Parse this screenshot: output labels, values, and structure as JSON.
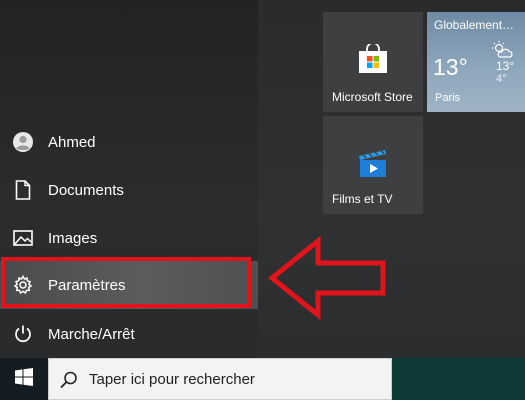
{
  "start_menu": {
    "items": [
      {
        "label": "Ahmed",
        "icon": "user-avatar-icon"
      },
      {
        "label": "Documents",
        "icon": "document-icon"
      },
      {
        "label": "Images",
        "icon": "image-icon"
      },
      {
        "label": "Paramètres",
        "icon": "gear-icon",
        "highlighted": true
      },
      {
        "label": "Marche/Arrêt",
        "icon": "power-icon"
      }
    ],
    "highlight_color": "#e1141c"
  },
  "tiles": {
    "store": {
      "label": "Microsoft Store",
      "icon": "store-bag-icon"
    },
    "films": {
      "label": "Films et TV",
      "icon": "films-tv-icon"
    },
    "weather": {
      "condition": "Globalement…",
      "temp": "13°",
      "high": "13°",
      "low": "4°",
      "city": "Paris",
      "icon": "partly-sunny-icon"
    }
  },
  "taskbar": {
    "start_icon": "windows-logo-icon",
    "search_placeholder": "Taper ici pour rechercher",
    "search_icon": "search-icon"
  }
}
